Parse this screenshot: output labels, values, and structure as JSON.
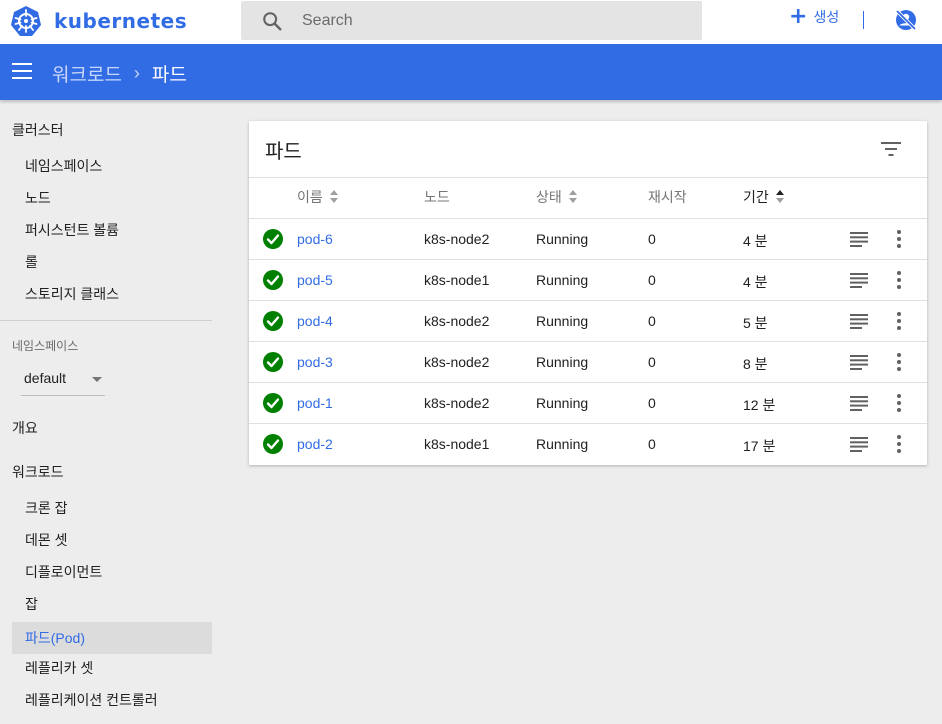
{
  "app": {
    "name": "kubernetes"
  },
  "search": {
    "placeholder": "Search"
  },
  "toolbar": {
    "create_label": "생성"
  },
  "breadcrumb": {
    "parent": "워크로드",
    "separator": "›",
    "current": "파드"
  },
  "sidebar": {
    "cluster_title": "클러스터",
    "cluster_items": [
      "네임스페이스",
      "노드",
      "퍼시스턴트 볼륨",
      "롤",
      "스토리지 클래스"
    ],
    "namespace_label": "네임스페이스",
    "namespace_value": "default",
    "overview": "개요",
    "workloads_title": "워크로드",
    "workload_items": [
      "크론 잡",
      "데몬 셋",
      "디플로이먼트",
      "잡",
      "파드(Pod)",
      "레플리카 셋",
      "레플리케이션 컨트롤러"
    ],
    "active_item": "파드(Pod)"
  },
  "card": {
    "title": "파드",
    "columns": [
      "이름",
      "노드",
      "상태",
      "재시작",
      "기간"
    ],
    "sorted_column": "기간",
    "rows": [
      {
        "name": "pod-6",
        "node": "k8s-node2",
        "status": "Running",
        "restarts": "0",
        "age": "4 분"
      },
      {
        "name": "pod-5",
        "node": "k8s-node1",
        "status": "Running",
        "restarts": "0",
        "age": "4 분"
      },
      {
        "name": "pod-4",
        "node": "k8s-node2",
        "status": "Running",
        "restarts": "0",
        "age": "5 분"
      },
      {
        "name": "pod-3",
        "node": "k8s-node2",
        "status": "Running",
        "restarts": "0",
        "age": "8 분"
      },
      {
        "name": "pod-1",
        "node": "k8s-node2",
        "status": "Running",
        "restarts": "0",
        "age": "12 분"
      },
      {
        "name": "pod-2",
        "node": "k8s-node1",
        "status": "Running",
        "restarts": "0",
        "age": "17 분"
      }
    ]
  },
  "colors": {
    "brand": "#326ce5",
    "success": "#008000",
    "background": "#ededed"
  },
  "icons": [
    "kubernetes-logo-icon",
    "search-icon",
    "plus-icon",
    "user-icon",
    "menu-icon",
    "filter-icon",
    "check-circle-icon",
    "logs-icon",
    "more-vert-icon"
  ]
}
